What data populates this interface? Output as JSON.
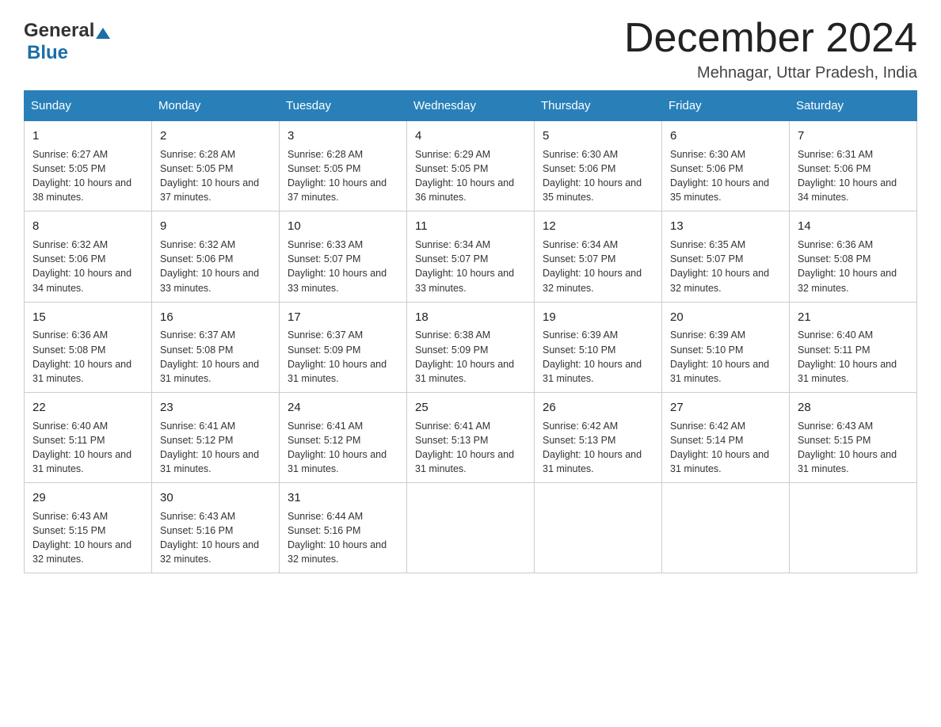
{
  "header": {
    "logo_general": "General",
    "logo_blue": "Blue",
    "month_title": "December 2024",
    "location": "Mehnagar, Uttar Pradesh, India"
  },
  "days_of_week": [
    "Sunday",
    "Monday",
    "Tuesday",
    "Wednesday",
    "Thursday",
    "Friday",
    "Saturday"
  ],
  "weeks": [
    [
      {
        "day": "1",
        "sunrise": "6:27 AM",
        "sunset": "5:05 PM",
        "daylight": "10 hours and 38 minutes."
      },
      {
        "day": "2",
        "sunrise": "6:28 AM",
        "sunset": "5:05 PM",
        "daylight": "10 hours and 37 minutes."
      },
      {
        "day": "3",
        "sunrise": "6:28 AM",
        "sunset": "5:05 PM",
        "daylight": "10 hours and 37 minutes."
      },
      {
        "day": "4",
        "sunrise": "6:29 AM",
        "sunset": "5:05 PM",
        "daylight": "10 hours and 36 minutes."
      },
      {
        "day": "5",
        "sunrise": "6:30 AM",
        "sunset": "5:06 PM",
        "daylight": "10 hours and 35 minutes."
      },
      {
        "day": "6",
        "sunrise": "6:30 AM",
        "sunset": "5:06 PM",
        "daylight": "10 hours and 35 minutes."
      },
      {
        "day": "7",
        "sunrise": "6:31 AM",
        "sunset": "5:06 PM",
        "daylight": "10 hours and 34 minutes."
      }
    ],
    [
      {
        "day": "8",
        "sunrise": "6:32 AM",
        "sunset": "5:06 PM",
        "daylight": "10 hours and 34 minutes."
      },
      {
        "day": "9",
        "sunrise": "6:32 AM",
        "sunset": "5:06 PM",
        "daylight": "10 hours and 33 minutes."
      },
      {
        "day": "10",
        "sunrise": "6:33 AM",
        "sunset": "5:07 PM",
        "daylight": "10 hours and 33 minutes."
      },
      {
        "day": "11",
        "sunrise": "6:34 AM",
        "sunset": "5:07 PM",
        "daylight": "10 hours and 33 minutes."
      },
      {
        "day": "12",
        "sunrise": "6:34 AM",
        "sunset": "5:07 PM",
        "daylight": "10 hours and 32 minutes."
      },
      {
        "day": "13",
        "sunrise": "6:35 AM",
        "sunset": "5:07 PM",
        "daylight": "10 hours and 32 minutes."
      },
      {
        "day": "14",
        "sunrise": "6:36 AM",
        "sunset": "5:08 PM",
        "daylight": "10 hours and 32 minutes."
      }
    ],
    [
      {
        "day": "15",
        "sunrise": "6:36 AM",
        "sunset": "5:08 PM",
        "daylight": "10 hours and 31 minutes."
      },
      {
        "day": "16",
        "sunrise": "6:37 AM",
        "sunset": "5:08 PM",
        "daylight": "10 hours and 31 minutes."
      },
      {
        "day": "17",
        "sunrise": "6:37 AM",
        "sunset": "5:09 PM",
        "daylight": "10 hours and 31 minutes."
      },
      {
        "day": "18",
        "sunrise": "6:38 AM",
        "sunset": "5:09 PM",
        "daylight": "10 hours and 31 minutes."
      },
      {
        "day": "19",
        "sunrise": "6:39 AM",
        "sunset": "5:10 PM",
        "daylight": "10 hours and 31 minutes."
      },
      {
        "day": "20",
        "sunrise": "6:39 AM",
        "sunset": "5:10 PM",
        "daylight": "10 hours and 31 minutes."
      },
      {
        "day": "21",
        "sunrise": "6:40 AM",
        "sunset": "5:11 PM",
        "daylight": "10 hours and 31 minutes."
      }
    ],
    [
      {
        "day": "22",
        "sunrise": "6:40 AM",
        "sunset": "5:11 PM",
        "daylight": "10 hours and 31 minutes."
      },
      {
        "day": "23",
        "sunrise": "6:41 AM",
        "sunset": "5:12 PM",
        "daylight": "10 hours and 31 minutes."
      },
      {
        "day": "24",
        "sunrise": "6:41 AM",
        "sunset": "5:12 PM",
        "daylight": "10 hours and 31 minutes."
      },
      {
        "day": "25",
        "sunrise": "6:41 AM",
        "sunset": "5:13 PM",
        "daylight": "10 hours and 31 minutes."
      },
      {
        "day": "26",
        "sunrise": "6:42 AM",
        "sunset": "5:13 PM",
        "daylight": "10 hours and 31 minutes."
      },
      {
        "day": "27",
        "sunrise": "6:42 AM",
        "sunset": "5:14 PM",
        "daylight": "10 hours and 31 minutes."
      },
      {
        "day": "28",
        "sunrise": "6:43 AM",
        "sunset": "5:15 PM",
        "daylight": "10 hours and 31 minutes."
      }
    ],
    [
      {
        "day": "29",
        "sunrise": "6:43 AM",
        "sunset": "5:15 PM",
        "daylight": "10 hours and 32 minutes."
      },
      {
        "day": "30",
        "sunrise": "6:43 AM",
        "sunset": "5:16 PM",
        "daylight": "10 hours and 32 minutes."
      },
      {
        "day": "31",
        "sunrise": "6:44 AM",
        "sunset": "5:16 PM",
        "daylight": "10 hours and 32 minutes."
      },
      null,
      null,
      null,
      null
    ]
  ],
  "labels": {
    "sunrise": "Sunrise:",
    "sunset": "Sunset:",
    "daylight": "Daylight:"
  }
}
